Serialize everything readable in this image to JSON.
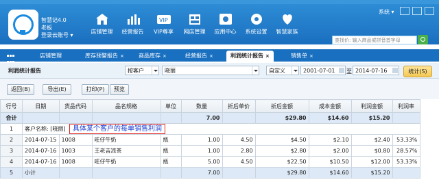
{
  "app": {
    "title": "智慧记4.0",
    "user": "老板",
    "account_label": "登录云账号 ▾"
  },
  "nav": [
    {
      "label": "店铺管理",
      "icon": "store-icon"
    },
    {
      "label": "经营报告",
      "icon": "bar-chart-icon"
    },
    {
      "label": "VIP尊享",
      "icon": "vip-icon"
    },
    {
      "label": "网店管理",
      "icon": "shop-icon"
    },
    {
      "label": "应用中心",
      "icon": "apps-icon"
    },
    {
      "label": "系统设置",
      "icon": "gear-icon"
    },
    {
      "label": "智慧家族",
      "icon": "family-icon"
    }
  ],
  "system_label": "系统 ▾",
  "search": {
    "placeholder": "查找价: 输入商品或拼音首字母"
  },
  "tabs": [
    {
      "label": "店铺管理",
      "active": false
    },
    {
      "label": "库存预警报告",
      "active": false
    },
    {
      "label": "商品库存",
      "active": false
    },
    {
      "label": "经营报告",
      "active": false
    },
    {
      "label": "利润统计报告",
      "active": true
    },
    {
      "label": "销售单",
      "active": false
    }
  ],
  "report": {
    "title": "利润统计报告",
    "group_by": "按客户",
    "customer": "晓丽",
    "period": "自定义",
    "date_from": "2001-07-01",
    "to_label": "至",
    "date_to": "2014-07-16",
    "stat_button": "统计(S)"
  },
  "toolbar": {
    "back": "返回(B)",
    "export": "导出(E)",
    "print": "打印(P)",
    "preview": "预览"
  },
  "table": {
    "headers": [
      "行号",
      "日期",
      "货品代码",
      "品名规格",
      "单位",
      "数量",
      "折后单价",
      "折后金额",
      "成本金额",
      "利润金额",
      "利润率"
    ],
    "total": {
      "label": "合计",
      "qty": "7.00",
      "amount": "$29.80",
      "cost": "$14.60",
      "profit": "$15.20"
    },
    "group": {
      "rownum": "1",
      "label": "客户名称: [晓丽]",
      "annotation": "具体某个客户的每单销售利润"
    },
    "rows": [
      {
        "rownum": "2",
        "date": "2014-07-15",
        "code": "1008",
        "name": "旺仔牛奶",
        "unit": "瓶",
        "qty": "1.00",
        "price": "4.50",
        "amount": "$4.50",
        "cost": "$2.10",
        "profit": "$2.40",
        "rate": "53.33%"
      },
      {
        "rownum": "3",
        "date": "2014-07-16",
        "code": "1003",
        "name": "王老吉凉茶",
        "unit": "瓶",
        "qty": "1.00",
        "price": "2.80",
        "amount": "$2.80",
        "cost": "$2.00",
        "profit": "$0.80",
        "rate": "28.57%"
      },
      {
        "rownum": "4",
        "date": "2014-07-16",
        "code": "1008",
        "name": "旺仔牛奶",
        "unit": "瓶",
        "qty": "5.00",
        "price": "4.50",
        "amount": "$22.50",
        "cost": "$10.50",
        "profit": "$12.00",
        "rate": "53.33%"
      }
    ],
    "subtotal": {
      "rownum": "5",
      "label": "小计",
      "qty": "7.00",
      "amount": "$29.80",
      "cost": "$14.60",
      "profit": "$15.20"
    }
  }
}
